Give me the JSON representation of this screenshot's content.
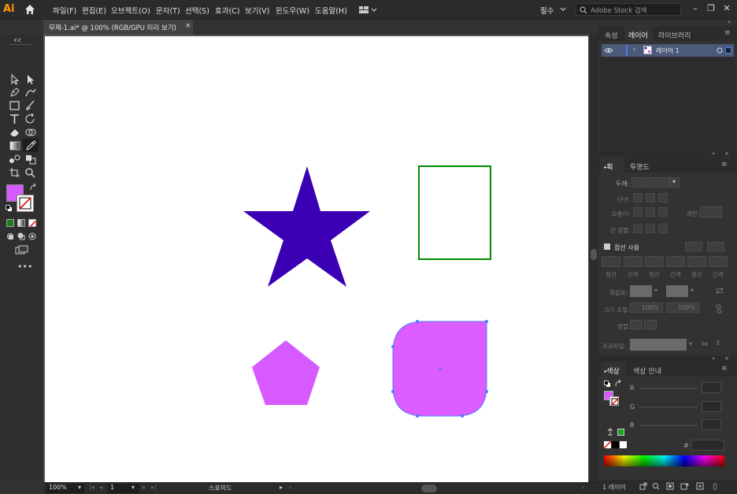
{
  "app": {
    "logo": "Ai"
  },
  "menu": [
    "파일(F)",
    "편집(E)",
    "오브젝트(O)",
    "문자(T)",
    "선택(S)",
    "효과(C)",
    "보기(V)",
    "윈도우(W)",
    "도움말(H)"
  ],
  "workspace": "필수",
  "search": {
    "placeholder": "Adobe Stock 검색"
  },
  "document": {
    "tab_title": "무제-1.ai* @ 100% (RGB/GPU 미리 보기)",
    "close": "×"
  },
  "status": {
    "zoom": "100%",
    "page": "1",
    "tool": "스포이드"
  },
  "panels": {
    "top_tabs": [
      "속성",
      "레이어",
      "라이브러리"
    ],
    "layer_name": "레이어 1",
    "stroke_tabs": [
      "획",
      "투명도"
    ],
    "stroke": {
      "weight_label": "두께:",
      "cap_label": "단면:",
      "corner_label": "모퉁이:",
      "limit_label": "제한:",
      "align_label": "선 정렬:",
      "dashed_label": "점선 사용",
      "dash_cols": [
        "점선",
        "간격",
        "점선",
        "간격",
        "점선",
        "간격"
      ],
      "arrow_label": "화살표:",
      "scale_label": "크기 조절:",
      "scale_a": "100%",
      "scale_b": "100%",
      "align2_label": "정렬:",
      "profile_label": "프로파일:"
    },
    "color_tabs": [
      "색상",
      "색상 안내"
    ],
    "color": {
      "r": "R",
      "g": "G",
      "b": "B",
      "hash": "#"
    },
    "bottom_layers": "1 레이어"
  },
  "colors": {
    "star": "#3b00b3",
    "pentagon": "#d65aff",
    "rounded_rect": "#dc5cff",
    "rect_stroke": "#008c00",
    "fill_swatch": "#d65aff",
    "selection": "#4a7bff"
  }
}
